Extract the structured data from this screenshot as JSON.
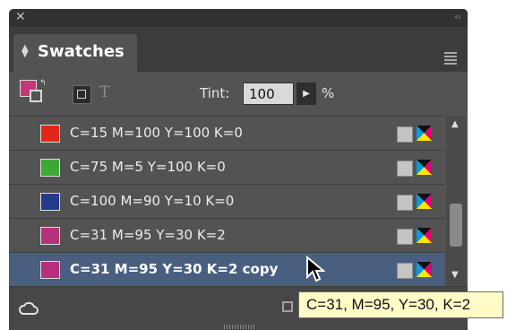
{
  "titlebar": {
    "close_icon": "close-x",
    "collapse_icon": "double-chevron-left"
  },
  "tab": {
    "label": "Swatches",
    "icon": "updown-arrows"
  },
  "panel_menu_icon": "hamburger",
  "toolbar": {
    "fill_color": "#c4377a",
    "format_text_glyph": "T",
    "tint_label": "Tint:",
    "tint_value": "100",
    "tint_unit": "%"
  },
  "swatches": [
    {
      "name": "C=15 M=100 Y=100 K=0",
      "color": "#e1261c",
      "selected": false
    },
    {
      "name": "C=75 M=5 Y=100 K=0",
      "color": "#3aa935",
      "selected": false
    },
    {
      "name": "C=100 M=90 Y=10 K=0",
      "color": "#233a8c",
      "selected": false
    },
    {
      "name": "C=31 M=95 Y=30 K=2",
      "color": "#b7317a",
      "selected": false
    },
    {
      "name": "C=31 M=95 Y=30 K=2 copy",
      "color": "#b7317a",
      "selected": true
    }
  ],
  "tooltip": {
    "text": "C=31, M=95, Y=30, K=2"
  }
}
